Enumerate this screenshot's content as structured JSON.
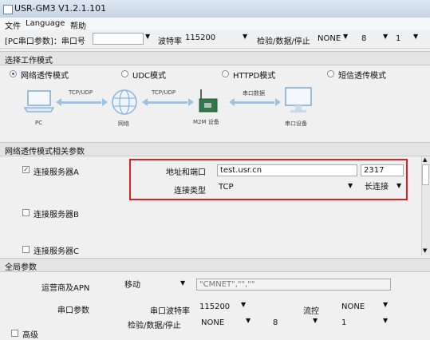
{
  "window": {
    "title": "USR-GM3 V1.2.1.101"
  },
  "menu": {
    "items": [
      "文件",
      "Language",
      "帮助"
    ]
  },
  "toolbar": {
    "port_label": "[PC串口参数]：串口号",
    "port_value": "",
    "baud_label": "波特率",
    "baud_value": "115200",
    "parity_label": "检验/数据/停止",
    "parity_value": "NONE",
    "data_value": "8",
    "stop_value": "1"
  },
  "mode_section": {
    "header": "选择工作模式",
    "modes": [
      "网络透传模式",
      "UDC模式",
      "HTTPD模式",
      "短信透传模式"
    ],
    "selected_index": 0,
    "diagram": {
      "pc": "PC",
      "net": "网络",
      "m2m": "M2M 设备",
      "serial": "串口设备",
      "tcpudp_1": "TCP/UDP",
      "tcpudp_2": "TCP/UDP",
      "serial_data": "串口数据"
    }
  },
  "params_section": {
    "header": "网络透传模式相关参数",
    "server_a": {
      "label": "连接服务器A",
      "checked": true
    },
    "server_b": {
      "label": "连接服务器B",
      "checked": false
    },
    "server_c": {
      "label": "连接服务器C",
      "checked": false
    },
    "address_label": "地址和端口",
    "address_value": "test.usr.cn",
    "port_value": "2317",
    "conn_type_label": "连接类型",
    "conn_type_value": "TCP",
    "conn_mode_value": "长连接"
  },
  "global_section": {
    "header": "全局参数",
    "apn_label": "运营商及APN",
    "apn_carrier": "移动",
    "apn_value": "\"CMNET\",\"\",\"\"",
    "serial_label": "串口参数",
    "baud_label": "串口波特率",
    "baud_value": "115200",
    "flow_label": "流控",
    "flow_value": "NONE",
    "parity_label": "检验/数据/停止",
    "parity_value": "NONE",
    "data_value": "8",
    "stop_value": "1",
    "advanced_label": "高级"
  },
  "colors": {
    "highlight_box": "#e02020",
    "accent": "#1a60c8"
  }
}
